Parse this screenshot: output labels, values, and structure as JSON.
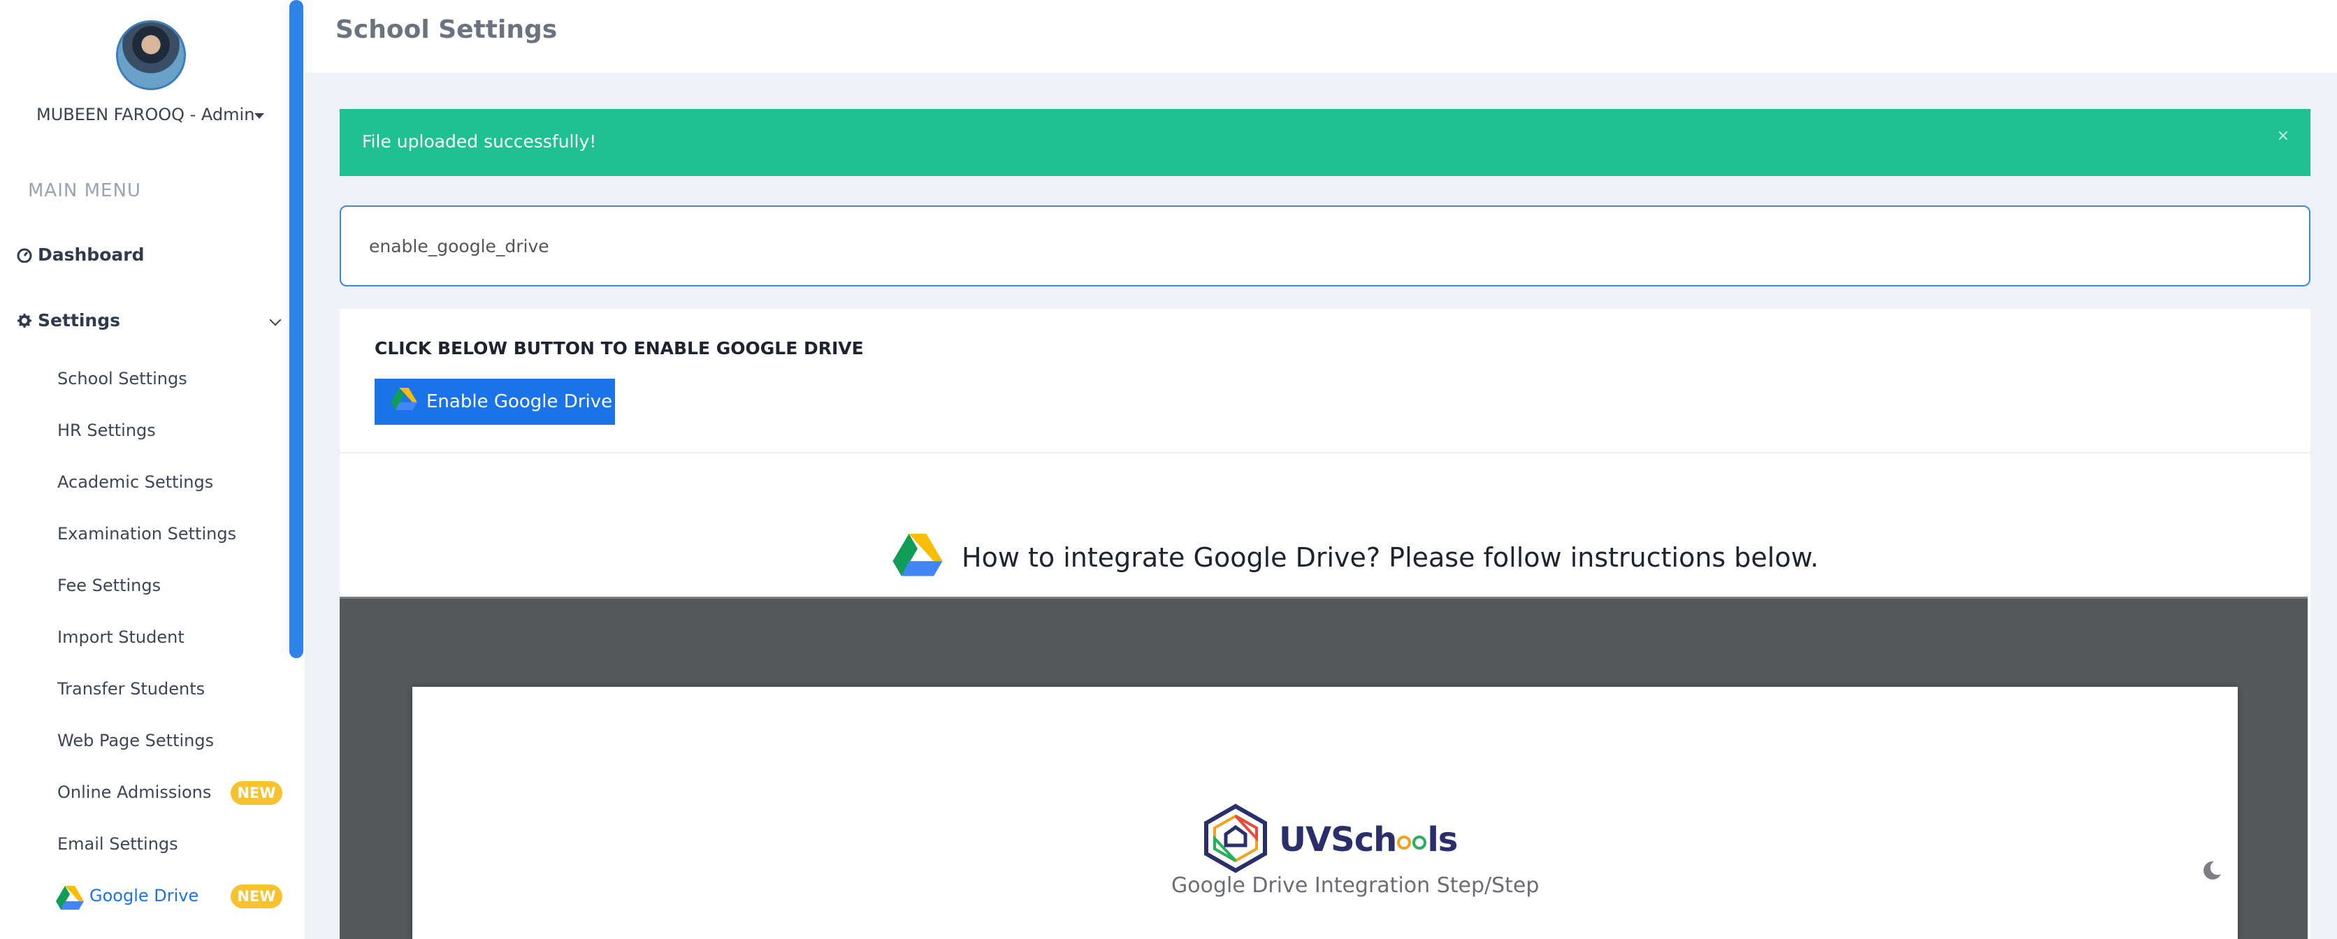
{
  "user": {
    "name": "MUBEEN FAROOQ - Admin"
  },
  "sidebar": {
    "section_label": "MAIN MENU",
    "dashboard": "Dashboard",
    "settings": "Settings",
    "items": [
      {
        "label": "School Settings"
      },
      {
        "label": "HR Settings"
      },
      {
        "label": "Academic Settings"
      },
      {
        "label": "Examination Settings"
      },
      {
        "label": "Fee Settings"
      },
      {
        "label": "Import Student"
      },
      {
        "label": "Transfer Students"
      },
      {
        "label": "Web Page Settings"
      },
      {
        "label": "Online Admissions",
        "badge": "NEW"
      },
      {
        "label": "Email Settings"
      },
      {
        "label": "Google Drive",
        "badge": "NEW",
        "active": true
      }
    ]
  },
  "header": {
    "title": "School Settings"
  },
  "alert": {
    "message": "File uploaded successfully!",
    "close": "×",
    "color": "#1fc092"
  },
  "config_input": {
    "value": "enable_google_drive"
  },
  "card": {
    "heading": "CLICK BELOW BUTTON TO ENABLE GOOGLE DRIVE",
    "button_label": "Enable Google Drive",
    "instructions": "How to integrate Google Drive? Please follow instructions below."
  },
  "preview": {
    "logo_text_prefix": "UVSch",
    "logo_text_suffix": "ls",
    "subtitle": "Google Drive Integration Step/Step"
  },
  "colors": {
    "accent": "#1a73e8",
    "badge": "#f7c22d"
  },
  "icons": [
    "dashboard-icon",
    "gear-icon",
    "google-drive-icon",
    "moon-icon",
    "uvschools-logo-icon"
  ]
}
